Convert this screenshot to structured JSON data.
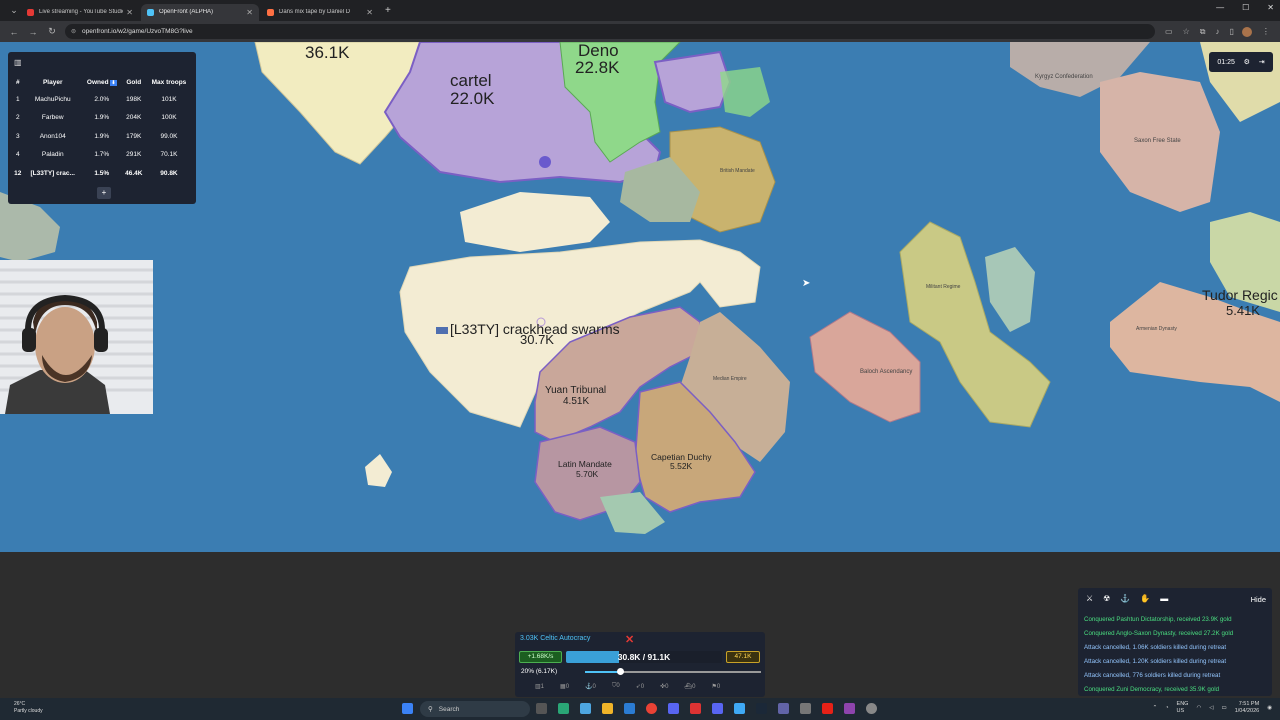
{
  "browser": {
    "tabs": [
      {
        "title": "Live streaming - YouTube Studio",
        "color": "#e53935"
      },
      {
        "title": "OpenFront (ALPHA)",
        "color": "#4fc3f7"
      },
      {
        "title": "Dans mix tape by Daniel D",
        "color": "#ff7043"
      }
    ],
    "url": "openfront.io/w2/game/UzvoTM8G?live"
  },
  "leaderboard": {
    "headers": [
      "#",
      "Player",
      "Owned",
      "Gold",
      "Max troops"
    ],
    "rows": [
      {
        "rank": "1",
        "player": "MachuPichu",
        "owned": "2.0%",
        "gold": "198K",
        "troops": "101K"
      },
      {
        "rank": "2",
        "player": "Farbew",
        "owned": "1.9%",
        "gold": "204K",
        "troops": "100K"
      },
      {
        "rank": "3",
        "player": "Anon104",
        "owned": "1.9%",
        "gold": "179K",
        "troops": "99.0K"
      },
      {
        "rank": "4",
        "player": "Paladin",
        "owned": "1.7%",
        "gold": "291K",
        "troops": "70.1K"
      },
      {
        "rank": "12",
        "player": "[L33TY] crac...",
        "owned": "1.5%",
        "gold": "46.4K",
        "troops": "90.8K"
      }
    ],
    "more": "+"
  },
  "timer": "01:25",
  "map_labels": {
    "top_left_val": "36.1K",
    "cartel_name": "cartel",
    "cartel_val": "22.0K",
    "deno_name": "Deno",
    "deno_val": "22.8K",
    "player_name": "[L33TY] crackhead swarms",
    "player_val": "30.7K",
    "yuan_name": "Yuan Tribunal",
    "yuan_val": "4.51K",
    "latin_name": "Latin Mandate",
    "latin_val": "5.70K",
    "capetian_name": "Capetian Duchy",
    "capetian_val": "5.52K",
    "tudor_name": "Tudor Regic",
    "tudor_val": "5.41K",
    "kyrgyz": "Kyrgyz Confederation",
    "saxon": "Saxon Free State",
    "british": "British Mandate",
    "median": "Median Empire",
    "baloch": "Baloch Ascendancy",
    "militant": "Militant Regime",
    "armenian": "Armenian Dynasty"
  },
  "events": {
    "hide": "Hide",
    "items": [
      {
        "text": "Conquered Pashtun Dictatorship, received 23.9K gold",
        "color": "#4ade80"
      },
      {
        "text": "Conquered Anglo-Saxon Dynasty, received 27.2K gold",
        "color": "#4ade80"
      },
      {
        "text": "Attack cancelled, 1.06K soldiers killed during retreat",
        "color": "#93c5fd"
      },
      {
        "text": "Attack cancelled, 1.20K soldiers killed during retreat",
        "color": "#93c5fd"
      },
      {
        "text": "Attack cancelled, 776 soldiers killed during retreat",
        "color": "#93c5fd"
      },
      {
        "text": "Conquered Zuni Democracy, received 35.9K gold",
        "color": "#4ade80"
      }
    ]
  },
  "control": {
    "nation": "3.03K  Celtic Autocracy",
    "rate": "+1.68K/s",
    "troops": "30.8K / 91.1K",
    "troops_fraction": 0.338,
    "gold": "47.1K",
    "ratio": "20% (6.17K)",
    "ratio_fraction": 0.2,
    "unit_counts": [
      "1",
      "0",
      "0",
      "0",
      "0",
      "0",
      "0",
      "0"
    ]
  },
  "taskbar": {
    "weather_temp": "26°C",
    "weather_desc": "Partly cloudy",
    "search": "Search",
    "lang": "ENG\nUS",
    "time": "7:51 PM",
    "date": "1/04/2026"
  }
}
